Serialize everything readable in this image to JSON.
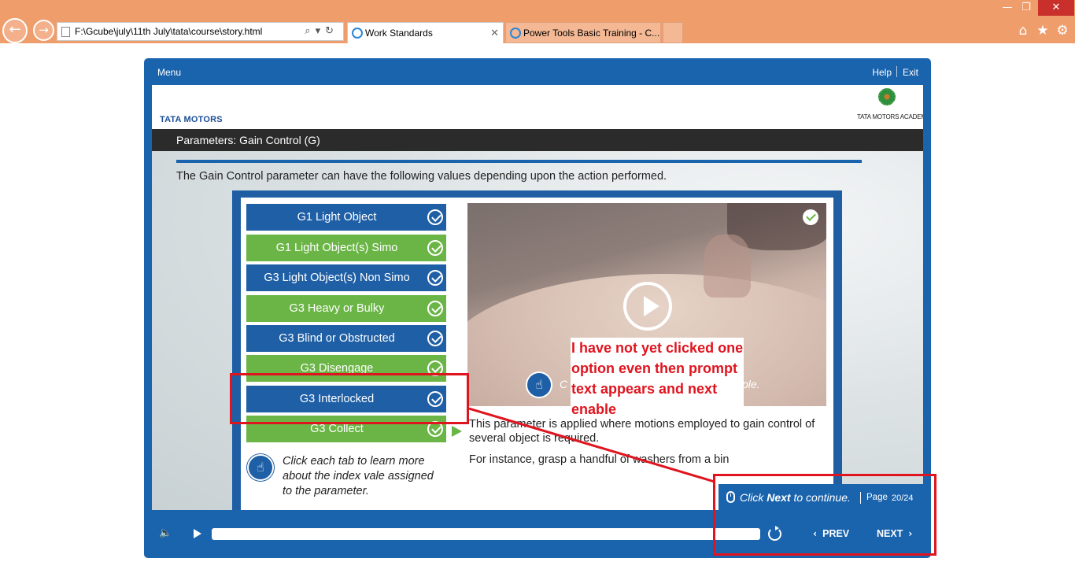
{
  "browser": {
    "address": "F:\\Gcube\\july\\11th July\\tata\\course\\story.html",
    "tabs": [
      {
        "label": "Work Standards"
      },
      {
        "label": "Power Tools Basic Training - C..."
      }
    ]
  },
  "player": {
    "menu_label": "Menu",
    "help_label": "Help",
    "exit_label": "Exit"
  },
  "slide": {
    "brand_logo": "TATA MOTORS",
    "academy_logo": "TATA MOTORS ACADEMY",
    "title": "Parameters: Gain Control (G)",
    "intro": "The Gain Control parameter can have the following  values depending upon the action performed.",
    "options": [
      {
        "label": "G1 Light Object",
        "color": "blue"
      },
      {
        "label": "G1 Light Object(s) Simo",
        "color": "green"
      },
      {
        "label": "G3 Light Object(s) Non Simo",
        "color": "blue"
      },
      {
        "label": "G3 Heavy or Bulky",
        "color": "green"
      },
      {
        "label": "G3 Blind or Obstructed",
        "color": "blue"
      },
      {
        "label": "G3 Disengage",
        "color": "green"
      },
      {
        "label": "G3 Interlocked",
        "color": "blue"
      },
      {
        "label": "G3 Collect",
        "color": "green"
      }
    ],
    "video_prompt_start": "C",
    "video_prompt_end": "ple.",
    "description_1": "This parameter is applied where motions employed to gain control of several object is required.",
    "description_2": "For instance, grasp a handful of washers from a bin",
    "hint": "Click each tab to learn more about the index vale assigned to the parameter.",
    "next_prompt_pre": "Click ",
    "next_prompt_bold": "Next",
    "next_prompt_post": " to continue.",
    "page_label": "Page",
    "page_count": "20/24"
  },
  "controls": {
    "prev_label": "PREV",
    "next_label": "NEXT"
  },
  "annotation": {
    "note": "I have not yet clicked one option even then prompt text appears and next enable"
  },
  "colors": {
    "player_blue": "#1a63ad",
    "option_blue": "#1f5fa6",
    "option_green": "#6ab545",
    "annotation_red": "#e0141e"
  }
}
